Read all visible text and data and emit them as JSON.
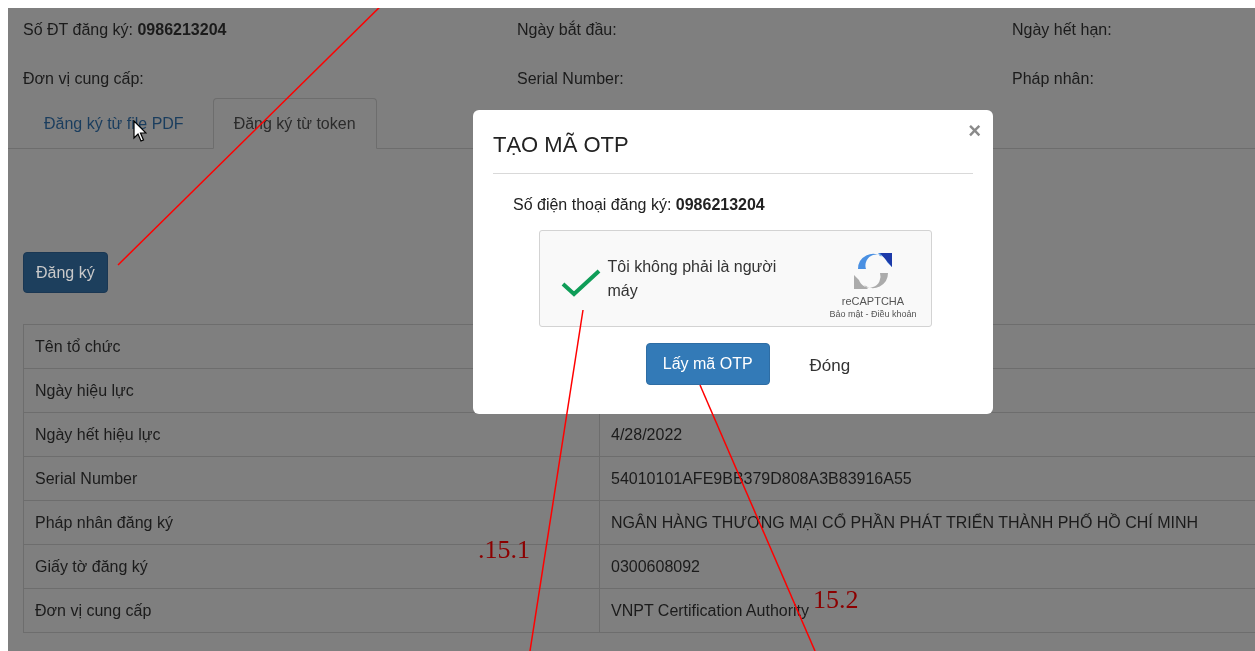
{
  "header_fields": [
    {
      "text": "Số ĐT đăng ký: **0986213204**"
    },
    {
      "text": "Ngày bắt đầu:"
    },
    {
      "text": "Ngày hết hạn:"
    },
    {
      "text": "Đơn vị cung cấp:"
    },
    {
      "text": "Serial Number:"
    },
    {
      "text": "Pháp nhân:"
    }
  ],
  "tabs": [
    {
      "label": "Đăng ký từ file PDF",
      "selected": false
    },
    {
      "label": "Đăng ký từ token",
      "selected": true
    }
  ],
  "register_button": "Đăng ký",
  "table": {
    "rows": [
      [
        "Tên tổ chức"
      ],
      [
        "Ngày hiệu lực"
      ],
      [
        "Ngày hết hiệu lực",
        "4/28/2022"
      ],
      [
        "Serial Number",
        "54010101AFE9BB379D808A3B83916A55"
      ],
      [
        "Pháp nhân đăng ký",
        "NGÂN HÀNG THƯƠNG MẠI CỔ PHẦN PHÁT TRIỂN THÀNH PHỐ HỒ CHÍ MINH"
      ],
      [
        "Giấy tờ đăng ký",
        "0300608092"
      ],
      [
        "Đơn vị cung cấp",
        "VNPT Certification Authority"
      ]
    ]
  },
  "dialog": {
    "title": "TẠO MÃ OTP",
    "close": "×",
    "phone": "Số điện thoại đăng ký: **0986213204**",
    "captcha": {
      "label": "Tôi không phải là người máy",
      "checked": true,
      "brand": "reCAPTCHA",
      "links": "Bảo mật - Điều khoản"
    },
    "buttons": [
      {
        "label": "Lấy mã OTP",
        "kind": "primary"
      },
      {
        "label": "Đóng",
        "kind": "link"
      }
    ]
  },
  "annotations": [
    ".15.1",
    "15.2"
  ]
}
